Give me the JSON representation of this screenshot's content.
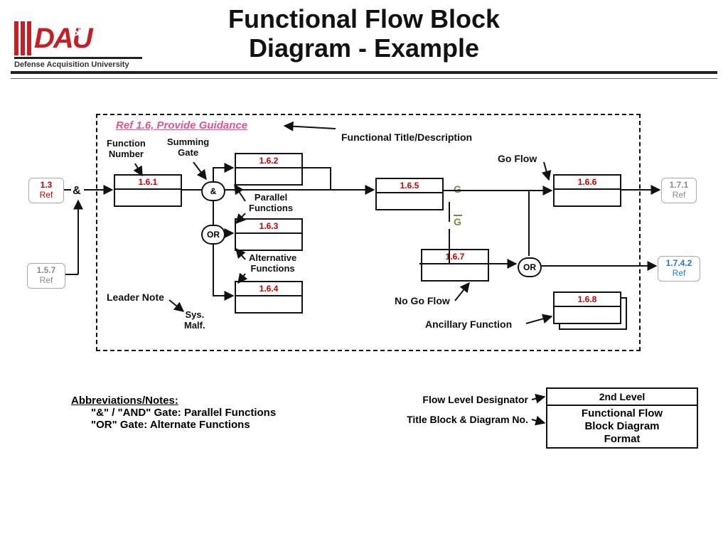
{
  "title_line1": "Functional Flow Block",
  "title_line2": "Diagram - Example",
  "logo_text": "DAU",
  "logo_sub": "Defense Acquisition University",
  "header_link": "Ref 1.6, Provide Guidance",
  "func_number_lbl": "Function\nNumber",
  "summing_gate_lbl": "Summing\nGate",
  "functional_title_lbl": "Functional Title/Description",
  "go_flow_lbl": "Go Flow",
  "parallel_lbl": "Parallel\nFunctions",
  "alternative_lbl": "Alternative\nFunctions",
  "leader_note_lbl": "Leader Note",
  "sys_malf_lbl": "Sys.\nMalf.",
  "no_go_lbl": "No Go Flow",
  "ancillary_lbl": "Ancillary Function",
  "amp": "&",
  "gate_and": "&",
  "gate_or": "OR",
  "G": "G",
  "blocks": {
    "b161": "1.6.1",
    "b162": "1.6.2",
    "b163": "1.6.3",
    "b164": "1.6.4",
    "b165": "1.6.5",
    "b166": "1.6.6",
    "b167": "1.6.7",
    "b168": "1.6.8"
  },
  "refs": {
    "r13": {
      "num": "1.3",
      "word": "Ref"
    },
    "r157": {
      "num": "1.5.7",
      "word": "Ref"
    },
    "r171": {
      "num": "1.7.1",
      "word": "Ref"
    },
    "r1742": {
      "num": "1.7.4.2",
      "word": "Ref"
    }
  },
  "notes": {
    "hd": "Abbreviations/Notes:",
    "l1": "\"&\" / \"AND\" Gate:  Parallel Functions",
    "l2": "\"OR\" Gate:  Alternate Functions"
  },
  "flowdesig": "Flow Level Designator",
  "titleblocklbl": "Title Block & Diagram No.",
  "tblock_top": "2nd Level",
  "tblock_bot": "Functional Flow\nBlock Diagram\nFormat"
}
